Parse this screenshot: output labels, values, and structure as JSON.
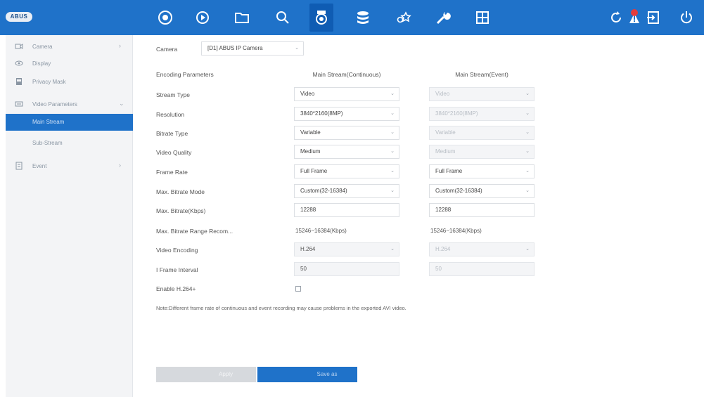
{
  "brand": {
    "logo_text": "ABUS"
  },
  "topbar": {
    "icons": [
      {
        "name": "live-view-icon"
      },
      {
        "name": "playback-icon"
      },
      {
        "name": "file-management-icon"
      },
      {
        "name": "smart-search-icon"
      },
      {
        "name": "camera-icon",
        "active": true
      },
      {
        "name": "storage-icon"
      },
      {
        "name": "system-config-icon"
      },
      {
        "name": "maintenance-icon"
      },
      {
        "name": "grid-layout-icon"
      },
      {
        "name": "refresh-icon"
      },
      {
        "name": "alarm-notification-icon"
      },
      {
        "name": "logout-icon"
      },
      {
        "name": "power-icon"
      }
    ],
    "accent_color": "#1f72c9"
  },
  "sidebar": {
    "items": [
      {
        "label": "Camera",
        "icon": "camera-sidebar-icon",
        "has_chevron": true
      },
      {
        "label": "Display",
        "icon": "display-eye-icon"
      },
      {
        "label": "Privacy Mask",
        "icon": "privacy-mask-icon"
      },
      {
        "label": "Video Parameters",
        "icon": "video-parameters-icon",
        "expanded": true
      },
      {
        "label": "Event",
        "icon": "event-icon",
        "has_chevron": true
      }
    ],
    "sub_items": [
      {
        "label": "Main Stream",
        "selected": true
      },
      {
        "label": "Sub-Stream"
      }
    ]
  },
  "main": {
    "camera_label": "Camera",
    "camera_value": "[D1] ABUS IP Camera",
    "encoding_header": "Encoding Parameters",
    "col_continuous": "Main Stream(Continuous)",
    "col_event": "Main Stream(Event)",
    "rows": {
      "stream_type": {
        "label": "Stream Type",
        "cont": "Video",
        "event": "Video"
      },
      "resolution": {
        "label": "Resolution",
        "cont": "3840*2160(8MP)",
        "event": "3840*2160(8MP)"
      },
      "bitrate_type": {
        "label": "Bitrate Type",
        "cont": "Variable",
        "event": "Variable"
      },
      "video_quality": {
        "label": "Video Quality",
        "cont": "Medium",
        "event": "Medium"
      },
      "frame_rate": {
        "label": "Frame Rate",
        "cont": "Full Frame",
        "event": "Full Frame"
      },
      "max_bitrate_mode": {
        "label": "Max. Bitrate Mode",
        "cont": "Custom(32-16384)",
        "event": "Custom(32-16384)"
      },
      "max_bitrate": {
        "label": "Max. Bitrate(Kbps)",
        "cont": "12288",
        "event": "12288"
      },
      "bitrate_range": {
        "label": "Max. Bitrate Range Recom...",
        "cont": "15246~16384(Kbps)",
        "event": "15246~16384(Kbps)"
      },
      "video_encoding": {
        "label": "Video Encoding",
        "cont": "H.264",
        "event": "H.264"
      },
      "iframe_interval": {
        "label": "I Frame Interval",
        "cont": "50",
        "event": "50"
      },
      "enable_h264plus": {
        "label": "Enable H.264+",
        "checked": false
      }
    },
    "note": "Note:Different frame rate of continuous and event recording may cause problems in the exported AVI video.",
    "apply_label": "Apply",
    "save_label": "Save as"
  }
}
